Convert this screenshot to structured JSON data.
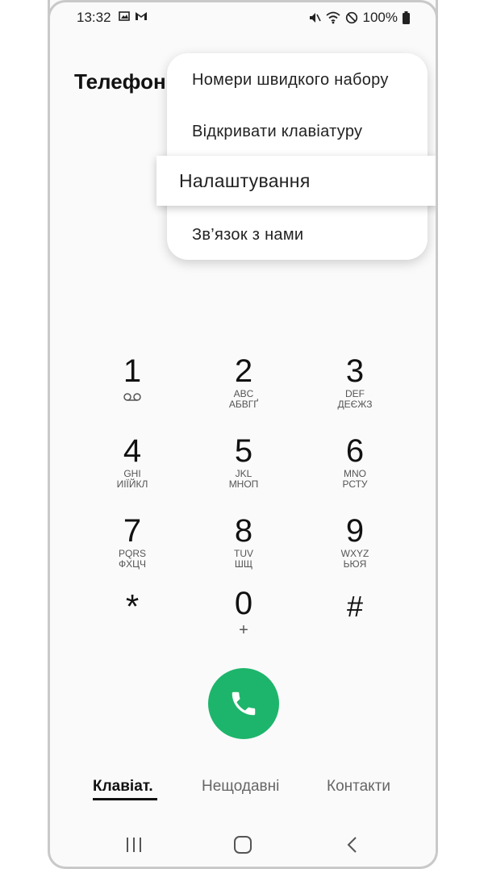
{
  "status_bar": {
    "time": "13:32",
    "battery": "100%",
    "left_icons": [
      "image-icon",
      "gmail-icon"
    ],
    "right_icons": [
      "mute-icon",
      "wifi-icon",
      "no-disturb-icon",
      "battery-icon"
    ]
  },
  "app": {
    "title": "Телефон"
  },
  "menu": {
    "items": [
      {
        "label": "Номери швидкого набору"
      },
      {
        "label": "Відкривати клавіатуру"
      },
      {
        "label": "Налаштування"
      },
      {
        "label": "Зв’язок з нами"
      }
    ]
  },
  "keypad": {
    "keys": [
      {
        "digit": "1",
        "sub1": "",
        "sub2": ""
      },
      {
        "digit": "2",
        "sub1": "ABC",
        "sub2": "АБВГҐ"
      },
      {
        "digit": "3",
        "sub1": "DEF",
        "sub2": "ДЕЄЖЗ"
      },
      {
        "digit": "4",
        "sub1": "GHI",
        "sub2": "ИІЇЙКЛ"
      },
      {
        "digit": "5",
        "sub1": "JKL",
        "sub2": "МНОП"
      },
      {
        "digit": "6",
        "sub1": "MNO",
        "sub2": "РСТУ"
      },
      {
        "digit": "7",
        "sub1": "PQRS",
        "sub2": "ФХЦЧ"
      },
      {
        "digit": "8",
        "sub1": "TUV",
        "sub2": "ШЩ"
      },
      {
        "digit": "9",
        "sub1": "WXYZ",
        "sub2": "ЬЮЯ"
      },
      {
        "digit": "*",
        "sub1": "",
        "sub2": ""
      },
      {
        "digit": "0",
        "sub1": "+",
        "sub2": ""
      },
      {
        "digit": "#",
        "sub1": "",
        "sub2": ""
      }
    ]
  },
  "tabs": [
    {
      "label": "Клавіат.",
      "active": true
    },
    {
      "label": "Нещодавні",
      "active": false
    },
    {
      "label": "Контакти",
      "active": false
    }
  ],
  "colors": {
    "call_button": "#1db56b",
    "background": "#fafafa"
  }
}
